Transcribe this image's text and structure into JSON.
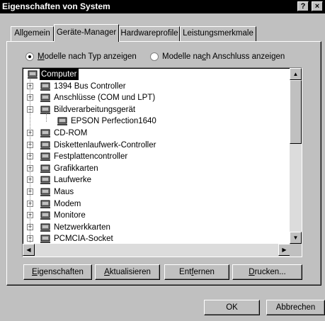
{
  "window": {
    "title": "Eigenschaften von System",
    "help_glyph": "?",
    "close_glyph": "×"
  },
  "tabs": [
    {
      "label": "Allgemein",
      "active": false
    },
    {
      "label": "Geräte-Manager",
      "active": true
    },
    {
      "label": "Hardwareprofile",
      "active": false
    },
    {
      "label": "Leistungsmerkmale",
      "active": false
    }
  ],
  "view_options": {
    "by_type": {
      "pre": "",
      "accel": "M",
      "post": "odelle nach Typ anzeigen",
      "selected": true
    },
    "by_connection": {
      "pre": "Modelle na",
      "accel": "c",
      "post": "h Anschluss anzeigen",
      "selected": false
    }
  },
  "tree": {
    "items": [
      {
        "label": "Computer",
        "icon": "computer-icon",
        "level": 0,
        "expander": "",
        "selected": true
      },
      {
        "label": "1394 Bus Controller",
        "icon": "bus-controller-icon",
        "level": 1,
        "expander": "+"
      },
      {
        "label": "Anschlüsse (COM und LPT)",
        "icon": "port-icon",
        "level": 1,
        "expander": "+"
      },
      {
        "label": "Bildverarbeitungsgerät",
        "icon": "imaging-device-icon",
        "level": 1,
        "expander": "−"
      },
      {
        "label": "EPSON Perfection1640",
        "icon": "scanner-icon",
        "level": 2,
        "expander": ""
      },
      {
        "label": "CD-ROM",
        "icon": "cdrom-icon",
        "level": 1,
        "expander": "+"
      },
      {
        "label": "Diskettenlaufwerk-Controller",
        "icon": "floppy-controller-icon",
        "level": 1,
        "expander": "+"
      },
      {
        "label": "Festplattencontroller",
        "icon": "harddisk-controller-icon",
        "level": 1,
        "expander": "+"
      },
      {
        "label": "Grafikkarten",
        "icon": "display-adapter-icon",
        "level": 1,
        "expander": "+"
      },
      {
        "label": "Laufwerke",
        "icon": "drive-icon",
        "level": 1,
        "expander": "+"
      },
      {
        "label": "Maus",
        "icon": "mouse-icon",
        "level": 1,
        "expander": "+"
      },
      {
        "label": "Modem",
        "icon": "modem-icon",
        "level": 1,
        "expander": "+"
      },
      {
        "label": "Monitore",
        "icon": "monitor-icon",
        "level": 1,
        "expander": "+"
      },
      {
        "label": "Netzwerkkarten",
        "icon": "network-adapter-icon",
        "level": 1,
        "expander": "+"
      },
      {
        "label": "PCMCIA-Socket",
        "icon": "pcmcia-icon",
        "level": 1,
        "expander": "+"
      }
    ]
  },
  "buttons": {
    "properties": {
      "pre": "",
      "accel": "E",
      "post": "igenschaften"
    },
    "refresh": {
      "pre": "",
      "accel": "A",
      "post": "ktualisieren"
    },
    "remove": {
      "pre": "Ent",
      "accel": "f",
      "post": "ernen"
    },
    "print": {
      "pre": "",
      "accel": "D",
      "post": "rucken..."
    },
    "ok": "OK",
    "cancel": "Abbrechen"
  },
  "colors": {
    "face": "#c0c0c0",
    "titlebar": "#000000",
    "selection": "#000000"
  }
}
